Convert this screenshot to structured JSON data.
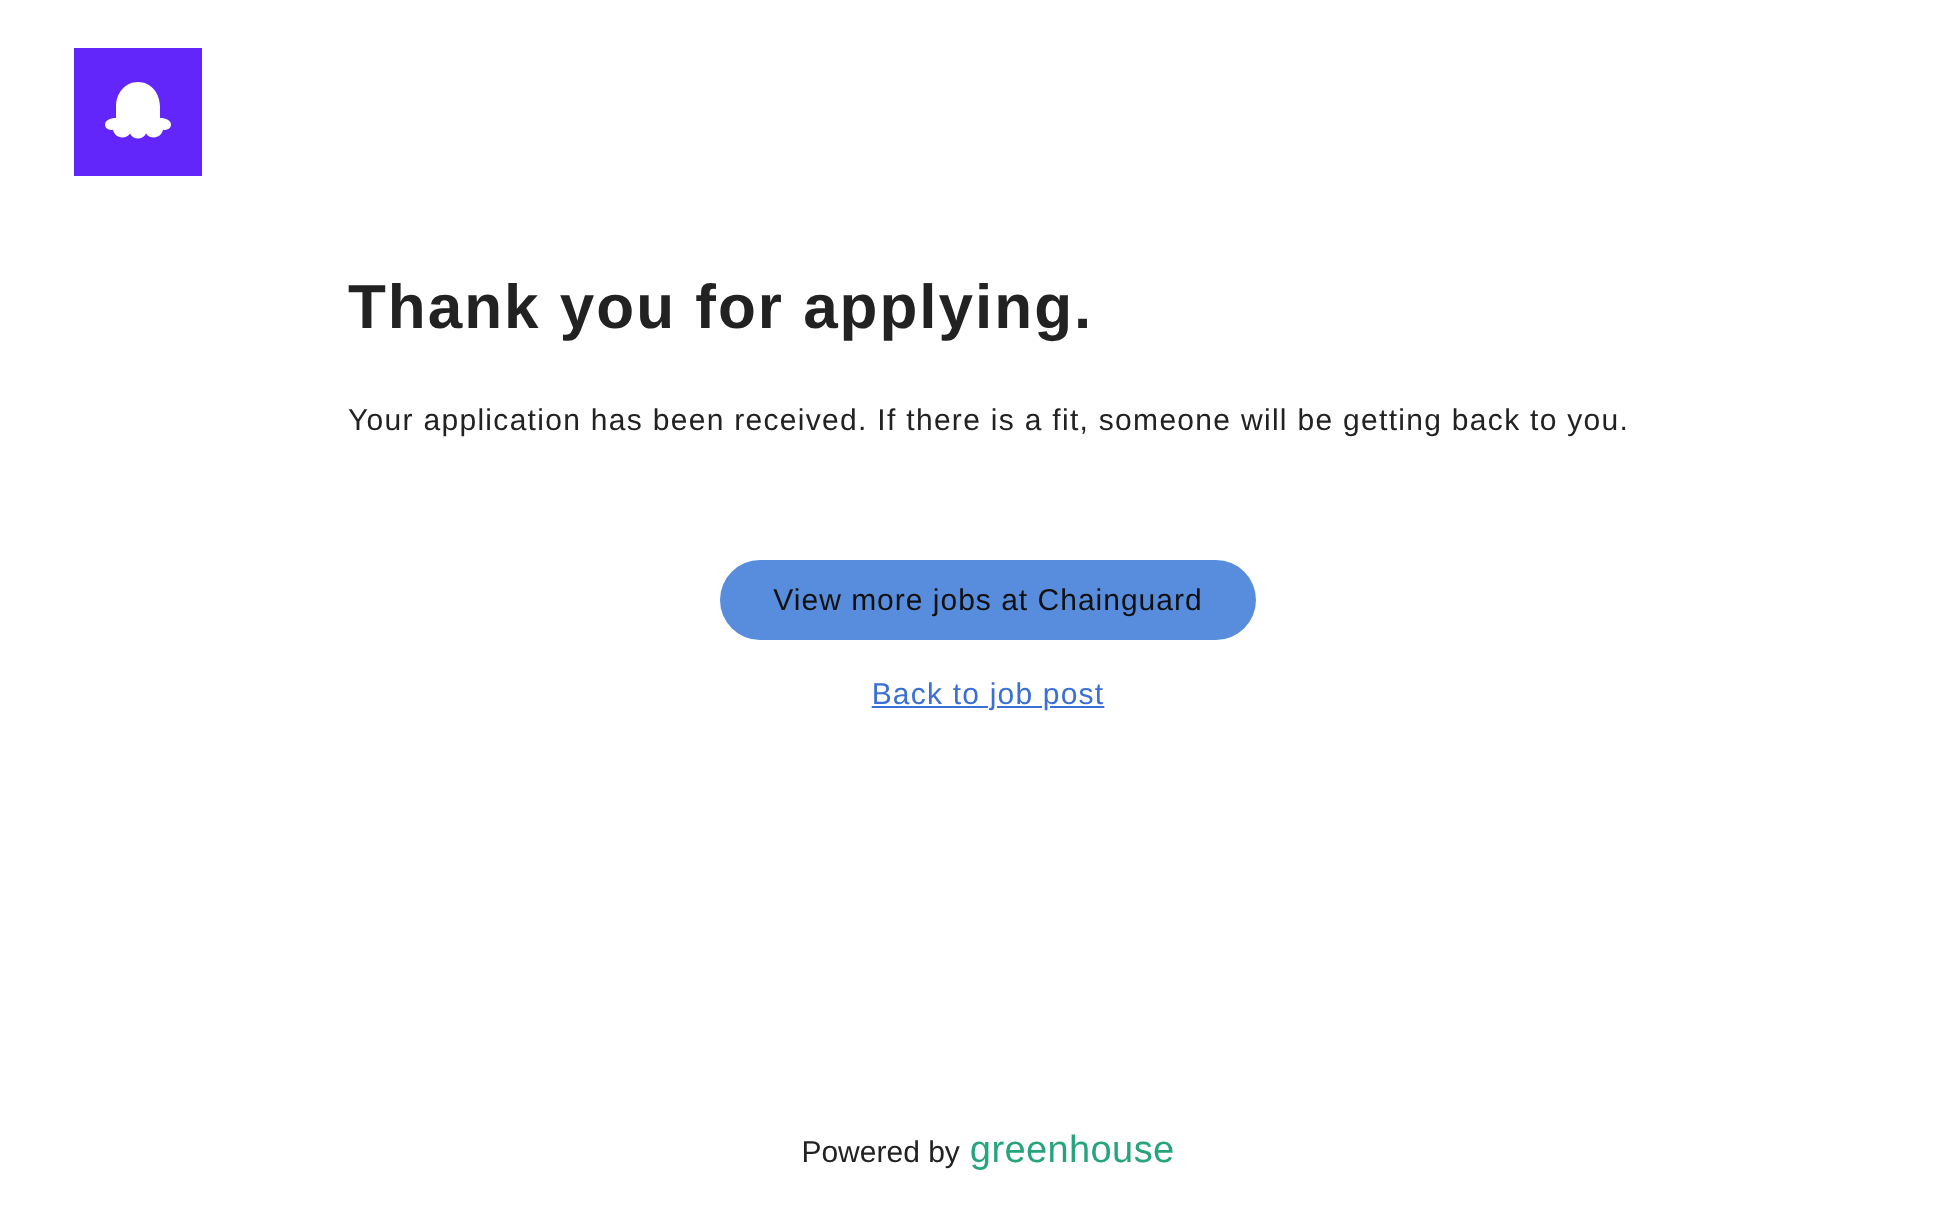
{
  "confirmation": {
    "heading": "Thank you for applying.",
    "message": "Your application has been received. If there is a fit, someone will be getting back to you."
  },
  "actions": {
    "primary_button": "View more jobs at Chainguard",
    "link": "Back to job post"
  },
  "footer": {
    "prefix": "Powered by",
    "brand": "greenhouse"
  }
}
